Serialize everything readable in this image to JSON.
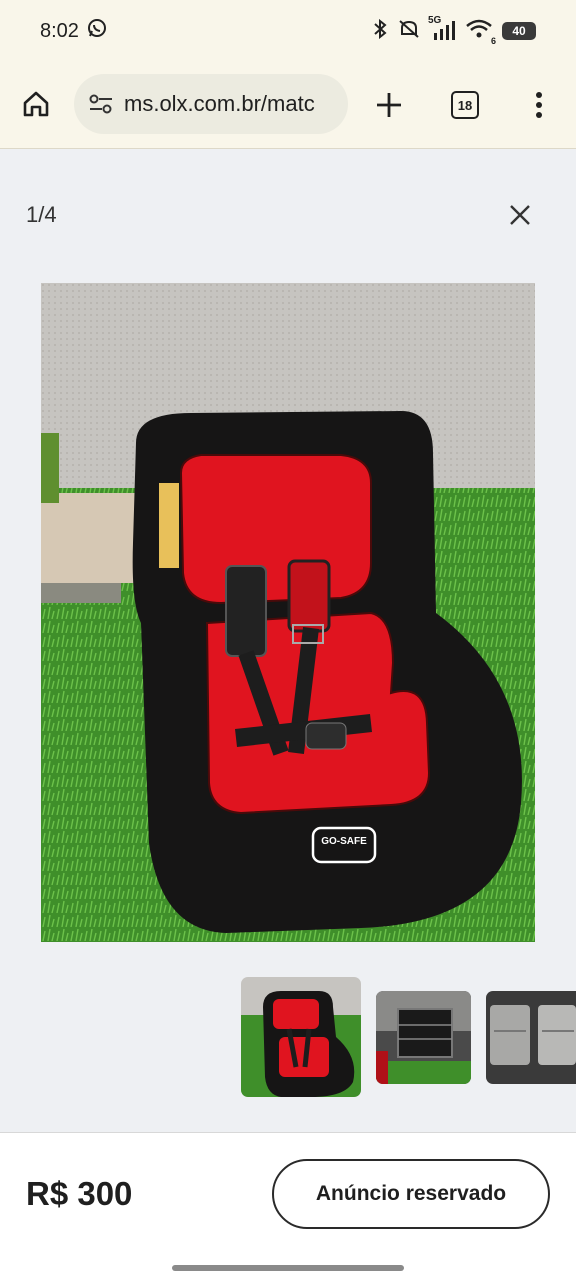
{
  "status": {
    "time": "8:02",
    "network_label": "5G",
    "wifi_label": "6",
    "battery": "40"
  },
  "browser": {
    "url": "ms.olx.com.br/matc",
    "tab_count": "18"
  },
  "gallery": {
    "counter": "1/4",
    "main_photo_label": "GO-SAFE"
  },
  "footer": {
    "price": "R$ 300",
    "button_label": "Anúncio reservado"
  },
  "icons": [
    "whatsapp-icon",
    "bluetooth-icon",
    "mute-icon",
    "signal-icon",
    "wifi-icon",
    "home-icon",
    "tune-icon",
    "plus-icon",
    "tabs-icon",
    "more-vert-icon",
    "close-icon"
  ],
  "colors": {
    "chrome_bg": "#f9f6ea",
    "page_bg": "#eef0f3",
    "seat_red": "#e0141f",
    "seat_black": "#161515",
    "grass": "#3f8f2a"
  }
}
